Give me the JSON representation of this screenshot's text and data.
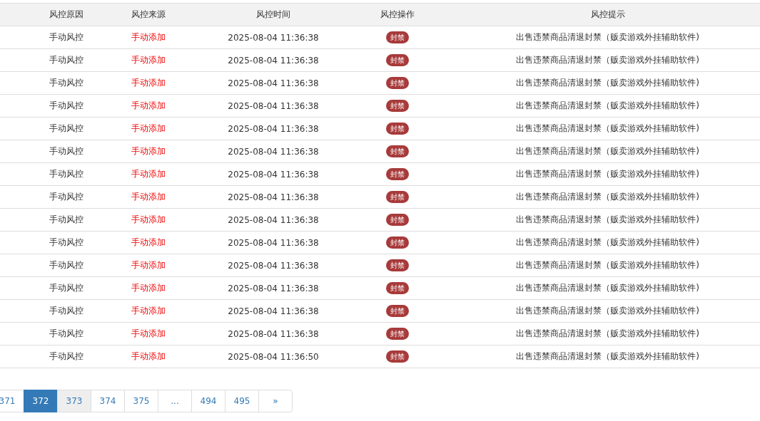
{
  "table": {
    "columns": [
      "风控原因",
      "风控来源",
      "风控时间",
      "风控操作",
      "风控提示"
    ],
    "rows": [
      {
        "reason": "手动风控",
        "source": "手动添加",
        "time": "2025-08-04 11:36:38",
        "action": "封禁",
        "hint": "出售违禁商品清退封禁（贩卖游戏外挂辅助软件)"
      },
      {
        "reason": "手动风控",
        "source": "手动添加",
        "time": "2025-08-04 11:36:38",
        "action": "封禁",
        "hint": "出售违禁商品清退封禁（贩卖游戏外挂辅助软件)"
      },
      {
        "reason": "手动风控",
        "source": "手动添加",
        "time": "2025-08-04 11:36:38",
        "action": "封禁",
        "hint": "出售违禁商品清退封禁（贩卖游戏外挂辅助软件)"
      },
      {
        "reason": "手动风控",
        "source": "手动添加",
        "time": "2025-08-04 11:36:38",
        "action": "封禁",
        "hint": "出售违禁商品清退封禁（贩卖游戏外挂辅助软件)"
      },
      {
        "reason": "手动风控",
        "source": "手动添加",
        "time": "2025-08-04 11:36:38",
        "action": "封禁",
        "hint": "出售违禁商品清退封禁（贩卖游戏外挂辅助软件)"
      },
      {
        "reason": "手动风控",
        "source": "手动添加",
        "time": "2025-08-04 11:36:38",
        "action": "封禁",
        "hint": "出售违禁商品清退封禁（贩卖游戏外挂辅助软件)"
      },
      {
        "reason": "手动风控",
        "source": "手动添加",
        "time": "2025-08-04 11:36:38",
        "action": "封禁",
        "hint": "出售违禁商品清退封禁（贩卖游戏外挂辅助软件)"
      },
      {
        "reason": "手动风控",
        "source": "手动添加",
        "time": "2025-08-04 11:36:38",
        "action": "封禁",
        "hint": "出售违禁商品清退封禁（贩卖游戏外挂辅助软件)"
      },
      {
        "reason": "手动风控",
        "source": "手动添加",
        "time": "2025-08-04 11:36:38",
        "action": "封禁",
        "hint": "出售违禁商品清退封禁（贩卖游戏外挂辅助软件)"
      },
      {
        "reason": "手动风控",
        "source": "手动添加",
        "time": "2025-08-04 11:36:38",
        "action": "封禁",
        "hint": "出售违禁商品清退封禁（贩卖游戏外挂辅助软件)"
      },
      {
        "reason": "手动风控",
        "source": "手动添加",
        "time": "2025-08-04 11:36:38",
        "action": "封禁",
        "hint": "出售违禁商品清退封禁（贩卖游戏外挂辅助软件)"
      },
      {
        "reason": "手动风控",
        "source": "手动添加",
        "time": "2025-08-04 11:36:38",
        "action": "封禁",
        "hint": "出售违禁商品清退封禁（贩卖游戏外挂辅助软件)"
      },
      {
        "reason": "手动风控",
        "source": "手动添加",
        "time": "2025-08-04 11:36:38",
        "action": "封禁",
        "hint": "出售违禁商品清退封禁（贩卖游戏外挂辅助软件)"
      },
      {
        "reason": "手动风控",
        "source": "手动添加",
        "time": "2025-08-04 11:36:38",
        "action": "封禁",
        "hint": "出售违禁商品清退封禁（贩卖游戏外挂辅助软件)"
      },
      {
        "reason": "手动风控",
        "source": "手动添加",
        "time": "2025-08-04 11:36:50",
        "action": "封禁",
        "hint": "出售违禁商品清退封禁（贩卖游戏外挂辅助软件)"
      }
    ]
  },
  "pagination": [
    {
      "label": "371",
      "selected": false,
      "hovered": false
    },
    {
      "label": "372",
      "selected": true,
      "hovered": false
    },
    {
      "label": "373",
      "selected": false,
      "hovered": true
    },
    {
      "label": "374",
      "selected": false,
      "hovered": false
    },
    {
      "label": "375",
      "selected": false,
      "hovered": false
    },
    {
      "label": "...",
      "selected": false,
      "hovered": false
    },
    {
      "label": "494",
      "selected": false,
      "hovered": false
    },
    {
      "label": "495",
      "selected": false,
      "hovered": false
    },
    {
      "label": "»",
      "selected": false,
      "hovered": false
    }
  ]
}
